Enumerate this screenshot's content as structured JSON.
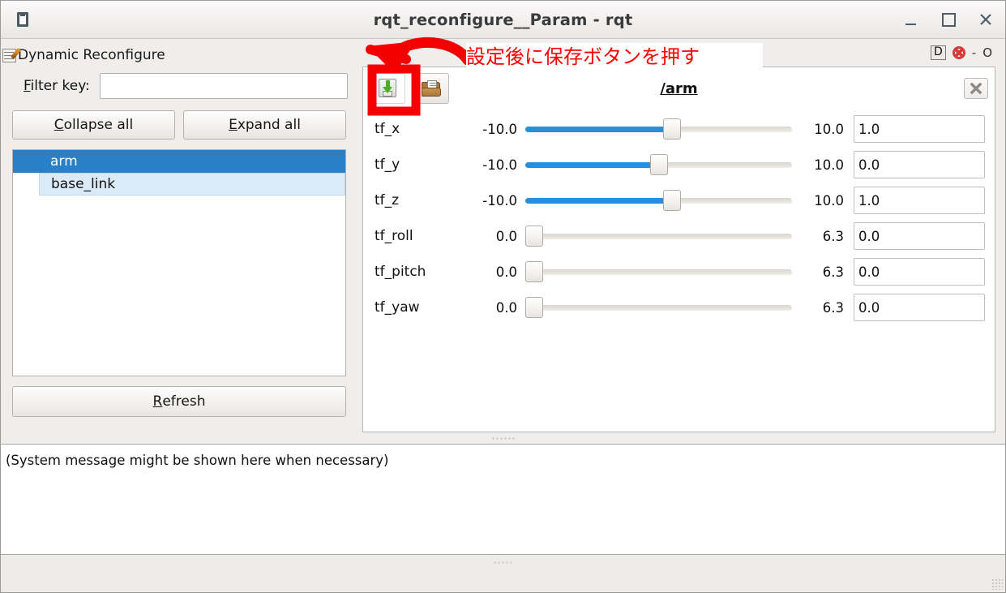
{
  "window": {
    "title": "rqt_reconfigure__Param - rqt",
    "app_icon": "window-icon",
    "minimize_label": "_",
    "maximize_label": "□",
    "close_label": "✕"
  },
  "annotation": {
    "text": "設定後に保存ボタンを押す",
    "color": "#ff0000",
    "arrow": "curved-arrow-pointing-to-save-button",
    "highlight_box": "red-rectangle-around-save-button"
  },
  "left_dock": {
    "title": "Dynamic Reconfigure",
    "title_icon": "pencil-edit-icon",
    "filter": {
      "label_prefix": "F",
      "label_rest": "ilter key:",
      "value": "",
      "placeholder": ""
    },
    "buttons": {
      "collapse_prefix": "C",
      "collapse_rest": "ollapse all",
      "expand_prefix": "E",
      "expand_rest": "xpand all",
      "refresh_prefix": "R",
      "refresh_rest": "efresh"
    },
    "tree_items": [
      {
        "label": "arm",
        "state": "selected"
      },
      {
        "label": "base_link",
        "state": "hover"
      }
    ]
  },
  "right_dock": {
    "header": {
      "d_badge": "D",
      "help_icon": "lifebuoy-help-icon",
      "dash": "-",
      "extra": "O"
    },
    "toolbar": {
      "save_icon": "save-floppy-disk-icon",
      "open_icon": "open-folder-icon"
    },
    "namespace_title": "/arm",
    "close_icon": "close-x-icon",
    "parameters": [
      {
        "name": "tf_x",
        "min": "-10.0",
        "max": "10.0",
        "value": "1.0",
        "pct": 55
      },
      {
        "name": "tf_y",
        "min": "-10.0",
        "max": "10.0",
        "value": "0.0",
        "pct": 50
      },
      {
        "name": "tf_z",
        "min": "-10.0",
        "max": "10.0",
        "value": "1.0",
        "pct": 55
      },
      {
        "name": "tf_roll",
        "min": "0.0",
        "max": "6.3",
        "value": "0.0",
        "pct": 0
      },
      {
        "name": "tf_pitch",
        "min": "0.0",
        "max": "6.3",
        "value": "0.0",
        "pct": 0
      },
      {
        "name": "tf_yaw",
        "min": "0.0",
        "max": "6.3",
        "value": "0.0",
        "pct": 0
      }
    ]
  },
  "console": {
    "message": "(System message might be shown here when necessary)"
  },
  "colors": {
    "selection_blue": "#2a7fc9",
    "slider_blue": "#2a8fd8",
    "annotation_red": "#ff0000",
    "window_bg": "#f0eeec"
  }
}
